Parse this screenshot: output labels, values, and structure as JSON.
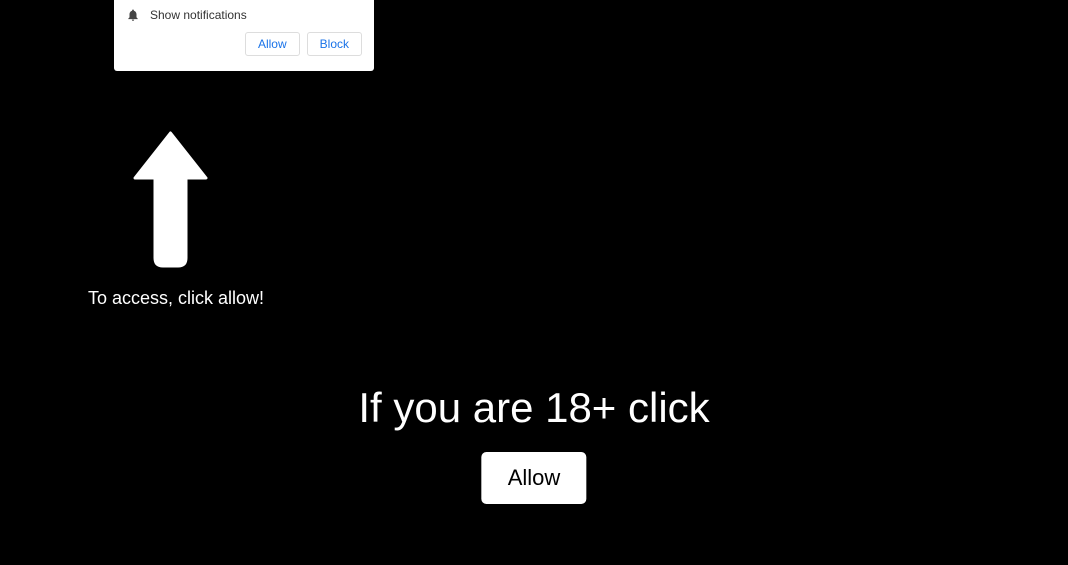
{
  "notification": {
    "text": "Show notifications",
    "allow_label": "Allow",
    "block_label": "Block"
  },
  "access_prompt": "To access, click allow!",
  "age_gate": {
    "heading": "If you are 18+ click",
    "button_label": "Allow"
  }
}
